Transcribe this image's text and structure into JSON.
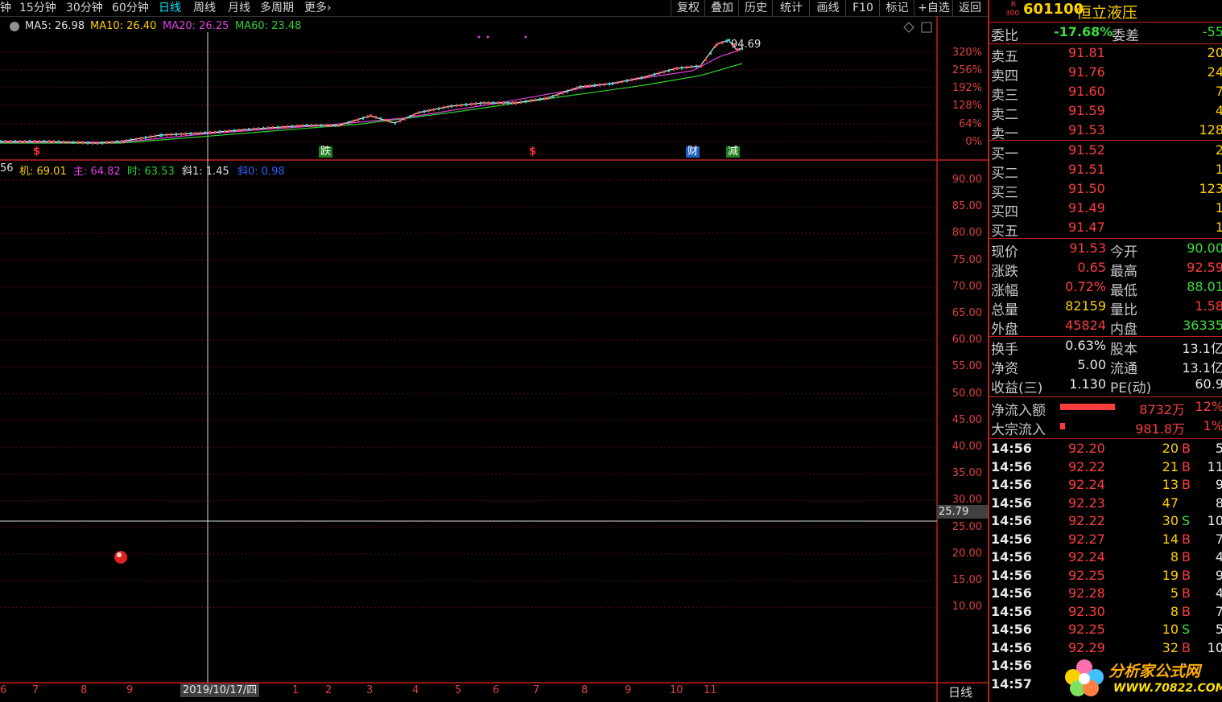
{
  "toolbar": {
    "periods": [
      "钟",
      "15分钟",
      "30分钟",
      "60分钟",
      "日线",
      "周线",
      "月线",
      "多周期",
      "更多"
    ],
    "active_period": "日线",
    "more_arrow": "›",
    "buttons": [
      "复权",
      "叠加",
      "历史",
      "统计",
      "画线",
      "F10",
      "标记",
      "+自选",
      "返回"
    ]
  },
  "main_chart": {
    "ma_labels": [
      {
        "text": "MA5: 26.98",
        "color": "#e0e0e0"
      },
      {
        "text": "MA10: 26.40",
        "color": "#ffd000"
      },
      {
        "text": "MA20: 26.25",
        "color": "#e040e0"
      },
      {
        "text": "MA60: 23.48",
        "color": "#30d030"
      }
    ],
    "peak_label": "94.69",
    "y_ticks": [
      "320%",
      "256%",
      "192%",
      "128%",
      "64%",
      "0%"
    ],
    "markers": [
      {
        "text": "$",
        "color": "#ff3030",
        "bg": "transparent"
      },
      {
        "text": "跌",
        "color": "#ffffff",
        "bg": "#208020"
      },
      {
        "text": "$",
        "color": "#ff3030",
        "bg": "transparent"
      },
      {
        "text": "财",
        "color": "#ffffff",
        "bg": "#2060c0"
      },
      {
        "text": "减",
        "color": "#ffffff",
        "bg": "#208020"
      }
    ]
  },
  "indicator": {
    "labels": [
      {
        "text": "56",
        "color": "#e0e0e0"
      },
      {
        "text": "机: 69.01",
        "color": "#ffd000"
      },
      {
        "text": "主: 64.82",
        "color": "#e040e0"
      },
      {
        "text": "时: 63.53",
        "color": "#30d030"
      },
      {
        "text": "斜1: 1.45",
        "color": "#e0e0e0"
      },
      {
        "text": "斜0: 0.98",
        "color": "#3060ff"
      }
    ],
    "y_ticks": [
      "90.00",
      "85.00",
      "80.00",
      "75.00",
      "70.00",
      "65.00",
      "60.00",
      "55.00",
      "50.00",
      "45.00",
      "40.00",
      "35.00",
      "30.00",
      "25.00",
      "20.00",
      "15.00",
      "10.00"
    ],
    "cursor_value": "25.79"
  },
  "x_axis": {
    "ticks": [
      "6",
      "7",
      "8",
      "9",
      "10",
      "1",
      "2",
      "3",
      "4",
      "5",
      "6",
      "7",
      "8",
      "9",
      "10",
      "11"
    ],
    "cursor_date": "2019/10/17/四",
    "period_label": "日线"
  },
  "quote": {
    "code": "601100",
    "name": "恒立液压",
    "badge_r": "R",
    "badge_num": "300",
    "webi_label": "委比",
    "webi_value": "-17.68%",
    "weicha_label": "委差",
    "weicha_value": "-55",
    "sells": [
      {
        "label": "卖五",
        "price": "91.81",
        "vol": "20"
      },
      {
        "label": "卖四",
        "price": "91.76",
        "vol": "24"
      },
      {
        "label": "卖三",
        "price": "91.60",
        "vol": "7"
      },
      {
        "label": "卖二",
        "price": "91.59",
        "vol": "4"
      },
      {
        "label": "卖一",
        "price": "91.53",
        "vol": "128"
      }
    ],
    "buys": [
      {
        "label": "买一",
        "price": "91.52",
        "vol": "2"
      },
      {
        "label": "买二",
        "price": "91.51",
        "vol": "1"
      },
      {
        "label": "买三",
        "price": "91.50",
        "vol": "123"
      },
      {
        "label": "买四",
        "price": "91.49",
        "vol": "1"
      },
      {
        "label": "买五",
        "price": "91.47",
        "vol": "1"
      }
    ],
    "stats1": [
      {
        "l1": "现价",
        "v1": "91.53",
        "l2": "今开",
        "v2": "90.00"
      },
      {
        "l1": "涨跌",
        "v1": "0.65",
        "l2": "最高",
        "v2": "92.59"
      },
      {
        "l1": "涨幅",
        "v1": "0.72%",
        "l2": "最低",
        "v2": "88.01"
      },
      {
        "l1": "总量",
        "v1": "82159",
        "l2": "量比",
        "v2": "1.58"
      },
      {
        "l1": "外盘",
        "v1": "45824",
        "l2": "内盘",
        "v2": "36335"
      }
    ],
    "stats2": [
      {
        "l1": "换手",
        "v1": "0.63%",
        "l2": "股本",
        "v2": "13.1亿"
      },
      {
        "l1": "净资",
        "v1": "5.00",
        "l2": "流通",
        "v2": "13.1亿"
      },
      {
        "l1": "收益(三)",
        "v1": "1.130",
        "l2": "PE(动)",
        "v2": "60.9"
      }
    ],
    "flows": [
      {
        "label": "净流入额",
        "value": "8732万",
        "pct": "12%",
        "ratio": 0.12
      },
      {
        "label": "大宗流入",
        "value": "981.8万",
        "pct": "1%",
        "ratio": 0.01
      }
    ],
    "ticks": [
      {
        "time": "14:56",
        "price": "92.20",
        "vol": "20",
        "side": "B",
        "n": "5"
      },
      {
        "time": "14:56",
        "price": "92.22",
        "vol": "21",
        "side": "B",
        "n": "11"
      },
      {
        "time": "14:56",
        "price": "92.24",
        "vol": "13",
        "side": "B",
        "n": "9"
      },
      {
        "time": "14:56",
        "price": "92.23",
        "vol": "47",
        "side": "",
        "n": "8"
      },
      {
        "time": "14:56",
        "price": "92.22",
        "vol": "30",
        "side": "S",
        "n": "10"
      },
      {
        "time": "14:56",
        "price": "92.27",
        "vol": "14",
        "side": "B",
        "n": "7"
      },
      {
        "time": "14:56",
        "price": "92.24",
        "vol": "8",
        "side": "B",
        "n": "4"
      },
      {
        "time": "14:56",
        "price": "92.25",
        "vol": "19",
        "side": "B",
        "n": "9"
      },
      {
        "time": "14:56",
        "price": "92.28",
        "vol": "5",
        "side": "B",
        "n": "4"
      },
      {
        "time": "14:56",
        "price": "92.30",
        "vol": "8",
        "side": "B",
        "n": "7"
      },
      {
        "time": "14:56",
        "price": "92.25",
        "vol": "10",
        "side": "S",
        "n": "5"
      },
      {
        "time": "14:56",
        "price": "92.29",
        "vol": "32",
        "side": "B",
        "n": "10"
      },
      {
        "time": "14:56",
        "price": "",
        "vol": "",
        "side": "",
        "n": ""
      },
      {
        "time": "14:57",
        "price": "",
        "vol": "",
        "side": "",
        "n": ""
      }
    ]
  },
  "watermark": {
    "title": "分析家公式网",
    "url": "WWW.70822.COM"
  }
}
